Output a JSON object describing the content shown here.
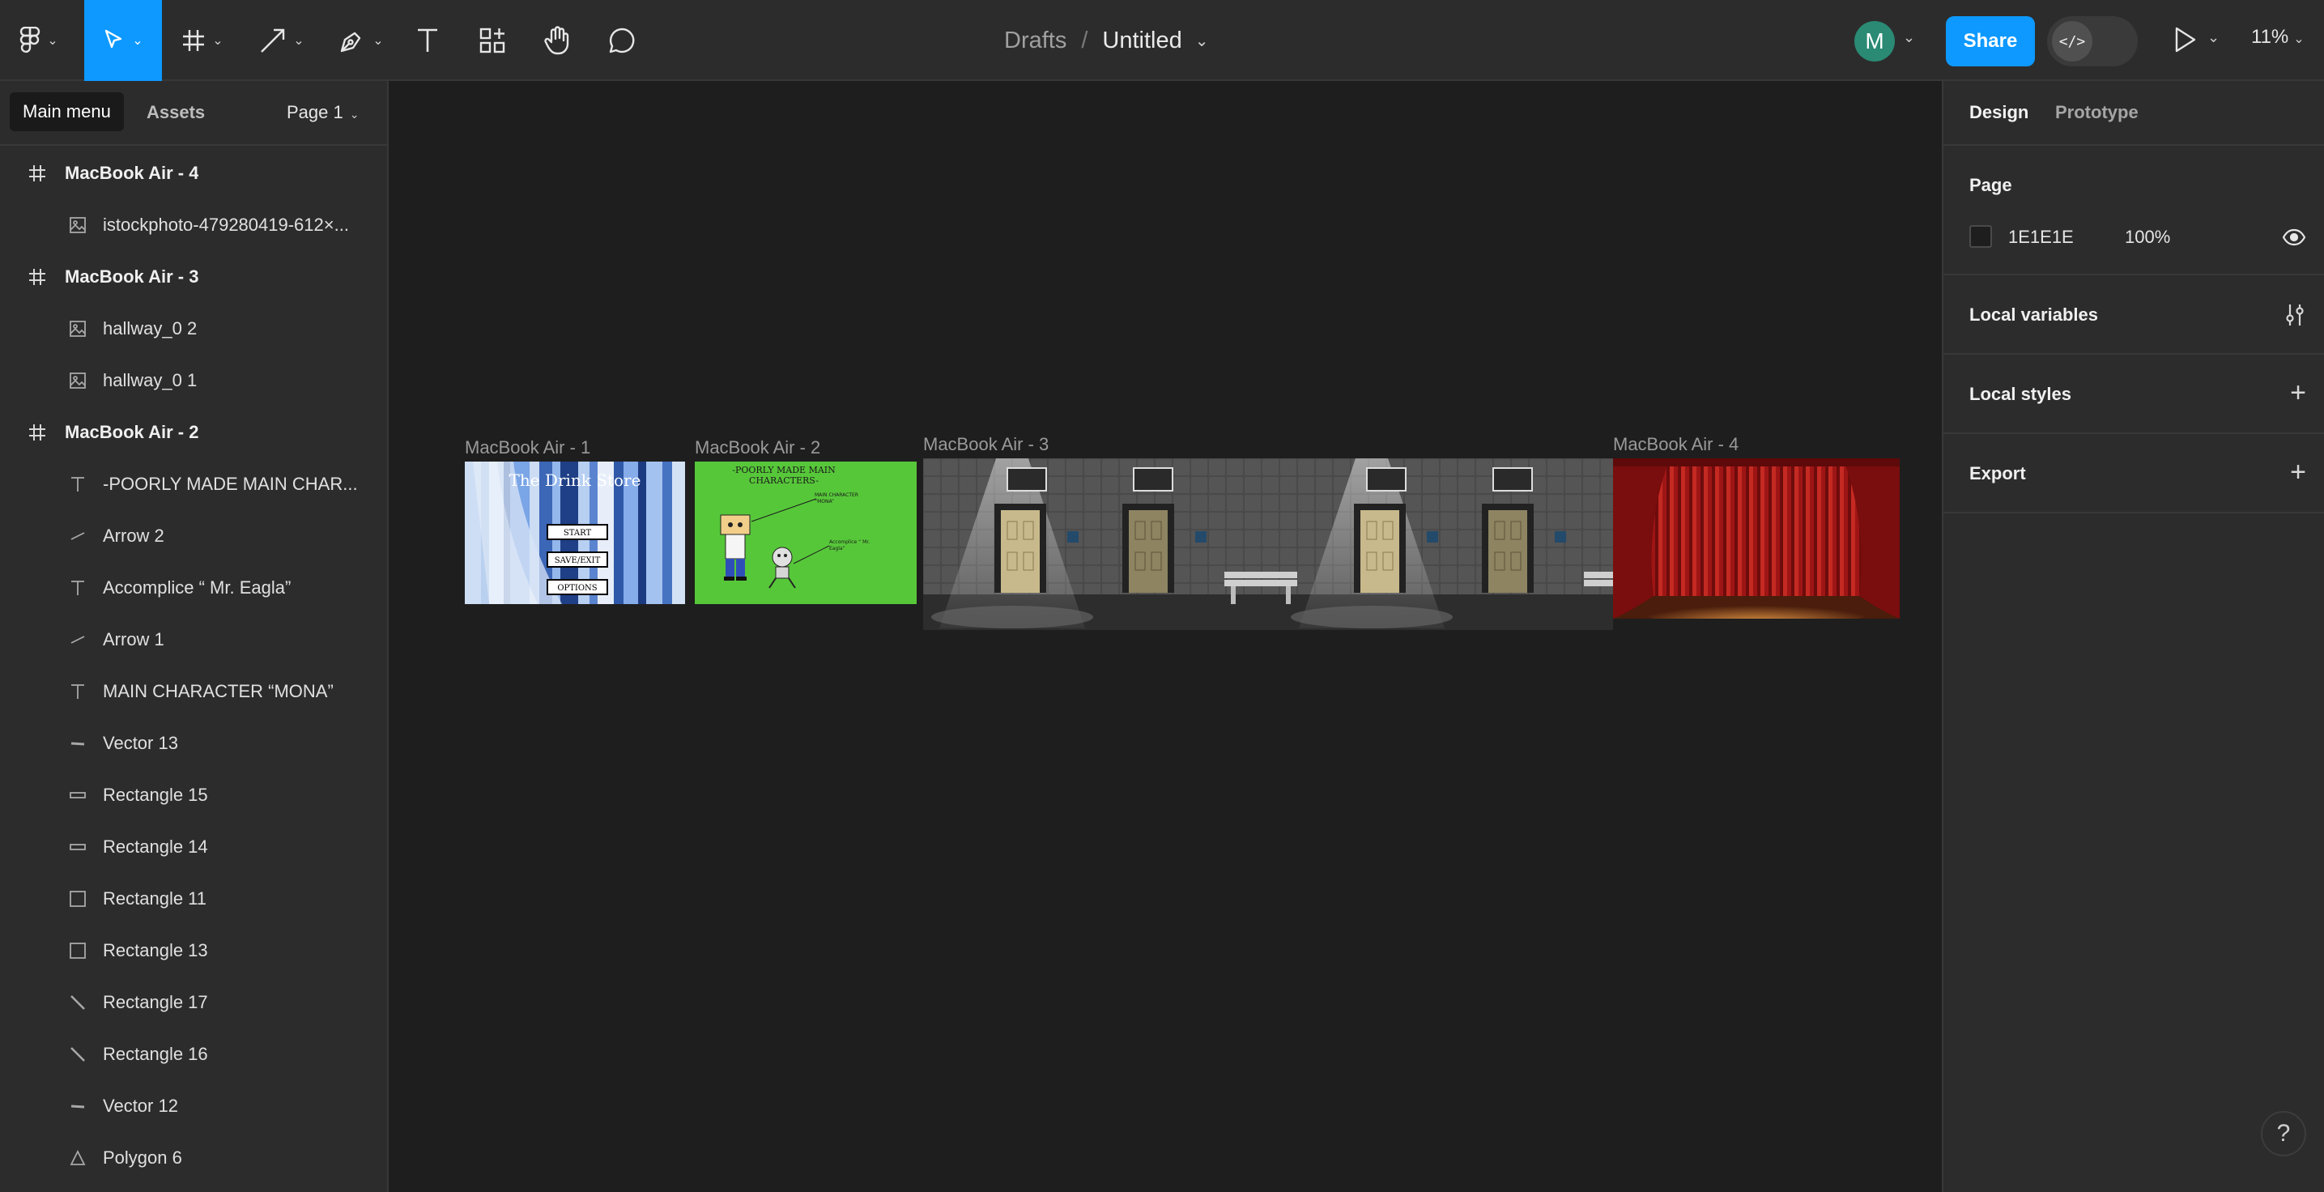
{
  "toolbar": {
    "tools": [
      {
        "name": "main-menu-button",
        "icon": "figma-logo-icon"
      },
      {
        "name": "move-tool-button",
        "icon": "cursor-arrow-icon",
        "active": true
      },
      {
        "name": "frame-tool-button",
        "icon": "frame-hash-icon"
      },
      {
        "name": "shape-tool-button",
        "icon": "arrow-line-icon"
      },
      {
        "name": "pen-tool-button",
        "icon": "pen-icon"
      },
      {
        "name": "text-tool-button",
        "icon": "text-t-icon"
      },
      {
        "name": "resources-button",
        "icon": "components-icon"
      },
      {
        "name": "hand-tool-button",
        "icon": "hand-icon"
      },
      {
        "name": "comment-tool-button",
        "icon": "comment-bubble-icon"
      }
    ],
    "breadcrumb_root": "Drafts",
    "breadcrumb_sep": "/",
    "file_title": "Untitled",
    "avatar_initial": "M",
    "share_label": "Share",
    "dev_mode_glyph": "</>",
    "zoom_label": "11%",
    "accent_color": "#0d99ff"
  },
  "left_panel": {
    "tooltip": "Main menu",
    "assets_tab": "Assets",
    "page_selector": "Page 1",
    "layers": [
      {
        "label": "MacBook Air - 4",
        "kind": "frame",
        "icon": "frame-hash-icon"
      },
      {
        "label": "istockphoto-479280419-612×...",
        "kind": "child",
        "icon": "image-icon"
      },
      {
        "label": "MacBook Air - 3",
        "kind": "frame",
        "icon": "frame-hash-icon"
      },
      {
        "label": "hallway_0 2",
        "kind": "child",
        "icon": "image-icon"
      },
      {
        "label": "hallway_0 1",
        "kind": "child",
        "icon": "image-icon"
      },
      {
        "label": "MacBook Air - 2",
        "kind": "frame",
        "icon": "frame-hash-icon"
      },
      {
        "label": "-POORLY MADE MAIN CHAR...",
        "kind": "child",
        "icon": "text-t-icon"
      },
      {
        "label": "Arrow 2",
        "kind": "child",
        "icon": "line-icon"
      },
      {
        "label": "Accomplice “ Mr. Eagla”",
        "kind": "child",
        "icon": "text-t-icon"
      },
      {
        "label": "Arrow 1",
        "kind": "child",
        "icon": "line-icon"
      },
      {
        "label": "MAIN CHARACTER “MONA”",
        "kind": "child",
        "icon": "text-t-icon"
      },
      {
        "label": "Vector 13",
        "kind": "child",
        "icon": "vector-icon"
      },
      {
        "label": "Rectangle 15",
        "kind": "child",
        "icon": "rectangle-thin-icon"
      },
      {
        "label": "Rectangle 14",
        "kind": "child",
        "icon": "rectangle-thin-icon"
      },
      {
        "label": "Rectangle 11",
        "kind": "child",
        "icon": "rectangle-icon"
      },
      {
        "label": "Rectangle 13",
        "kind": "child",
        "icon": "rectangle-icon"
      },
      {
        "label": "Rectangle 17",
        "kind": "child",
        "icon": "diagonal-line-icon"
      },
      {
        "label": "Rectangle 16",
        "kind": "child",
        "icon": "diagonal-line-icon"
      },
      {
        "label": "Vector 12",
        "kind": "child",
        "icon": "vector-icon"
      },
      {
        "label": "Polygon 6",
        "kind": "child",
        "icon": "triangle-icon"
      }
    ]
  },
  "canvas": {
    "background": "#1e1e1e",
    "frames": [
      {
        "label": "MacBook Air - 1",
        "title_text": "The Drink Store",
        "menu": [
          "START",
          "SAVE/EXIT",
          "OPTIONS"
        ]
      },
      {
        "label": "MacBook Air - 2",
        "heading": "-POORLY MADE MAIN CHARACTERS-",
        "note_main": "MAIN CHARACTER “MONA”",
        "note_accomplice": "Accomplice “ Mr. Eagla”"
      },
      {
        "label": "MacBook Air - 3"
      },
      {
        "label": "MacBook Air - 4"
      }
    ]
  },
  "right_panel": {
    "tabs": [
      "Design",
      "Prototype"
    ],
    "page_title": "Page",
    "page_color": "1E1E1E",
    "page_opacity": "100%",
    "local_variables": "Local variables",
    "local_styles": "Local styles",
    "export": "Export",
    "help": "?"
  }
}
